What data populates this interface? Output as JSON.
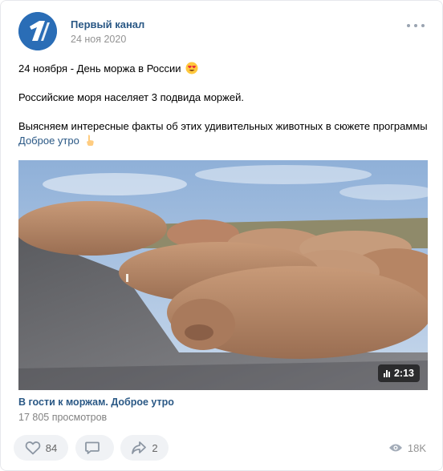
{
  "post": {
    "author": "Первый канал",
    "date": "24 ноя 2020",
    "line1": "24 ноября - День моржа в России",
    "line2": "Российские моря населяет 3 подвида моржей.",
    "line3": "Выясняем интересные факты об этих удивительных животных в сюжете программы",
    "link": "Доброе утро",
    "emoji_icons": [
      "heart-eyes-emoji-icon",
      "pointing-hand-emoji-icon"
    ]
  },
  "video": {
    "duration": "2:13",
    "title": "В гости к моржам. Доброе утро",
    "views": "17 805 просмотров"
  },
  "actions": {
    "likes": "84",
    "comments": "",
    "shares": "2",
    "views": "18K"
  },
  "colors": {
    "brand": "#2a5885",
    "avatar": "#2a6db6",
    "button_bg": "#f0f2f5",
    "muted": "#939393"
  }
}
